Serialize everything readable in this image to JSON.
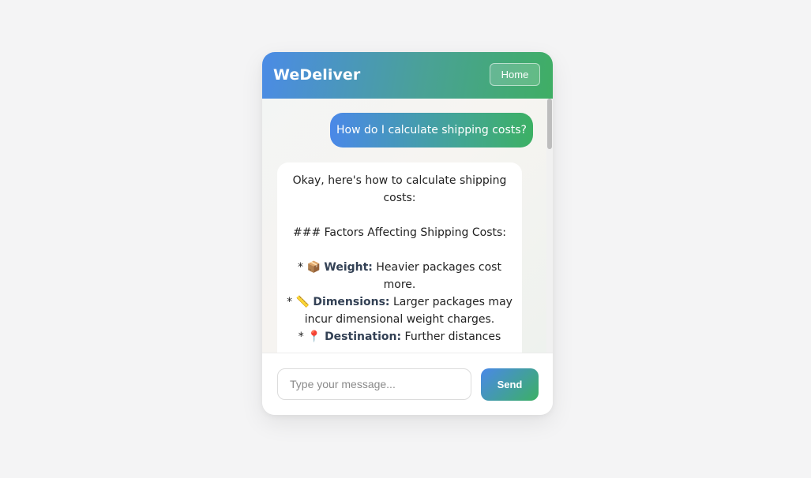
{
  "header": {
    "brand": "WeDeliver",
    "home_label": "Home"
  },
  "conversation": {
    "user_message": "How do I calculate shipping costs?",
    "bot_message": {
      "intro": "Okay, here's how to calculate shipping costs:",
      "heading": "### Factors Affecting Shipping Costs:",
      "items": [
        {
          "bullet": "*",
          "icon": "package-icon",
          "emoji": "📦",
          "term": "Weight:",
          "text": "Heavier packages cost more."
        },
        {
          "bullet": "*",
          "icon": "ruler-icon",
          "emoji": "📏",
          "term": "Dimensions:",
          "text": "Larger packages may incur dimensional weight charges."
        },
        {
          "bullet": "*",
          "icon": "pin-icon",
          "emoji": "📍",
          "term": "Destination:",
          "text": "Further distances"
        }
      ]
    }
  },
  "composer": {
    "placeholder": "Type your message...",
    "value": "",
    "send_label": "Send"
  },
  "colors": {
    "gradient_start": "#4a88e8",
    "gradient_end": "#3cb064"
  }
}
